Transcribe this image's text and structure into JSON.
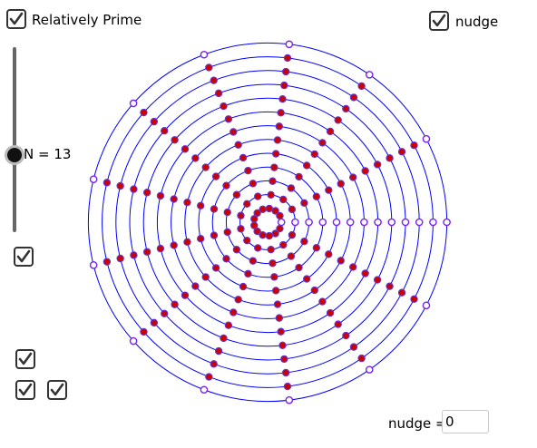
{
  "controls": {
    "relatively_prime_label": "Relatively Prime",
    "nudge_checkbox_label": "nudge",
    "n_label": "N = 13",
    "nudge_input_label": "nudge =",
    "nudge_input_value": "0"
  },
  "colors": {
    "ring": "#0000ff",
    "filled_dot": "#cc0000",
    "dot_outline": "#6633cc",
    "hollow_dot": "#7722ee"
  },
  "diagram": {
    "N": 13,
    "rings": [
      1,
      2,
      3,
      4,
      5,
      6,
      7,
      8,
      9,
      10,
      11,
      12,
      13
    ],
    "filled_rule": "n coprime with N"
  }
}
